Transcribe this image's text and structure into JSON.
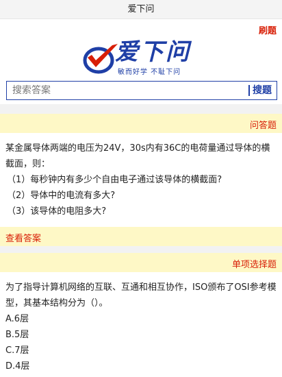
{
  "header": {
    "title": "爱下问"
  },
  "nav": {
    "shuati_label": "刷题"
  },
  "logo": {
    "title": "爱下问",
    "slogan": "敏而好学  不耻下问",
    "colors": {
      "blue": "#1f3fa6",
      "red": "#d81e06"
    }
  },
  "search": {
    "placeholder": "搜索答案",
    "button_label": "搜题"
  },
  "qa_section": {
    "label": "问答题",
    "question_line1": "某金属导体两端的电压为24V，30s内有36C的电荷量通过导体的横截面，则：",
    "sub_items": [
      "（1）每秒钟内有多少个自由电子通过该导体的横截面?",
      "（2）导体中的电流有多大?",
      "（3）该导体的电阻多大?"
    ],
    "view_answer_label": "查看答案"
  },
  "choice_section": {
    "label": "单项选择题",
    "question": "为了指导计算机网络的互联、互通和相互协作，ISO颁布了OSI参考模型，其基本结构分为（）。",
    "options": [
      "A.6层",
      "B.5层",
      "C.7层",
      "D.4层"
    ]
  }
}
